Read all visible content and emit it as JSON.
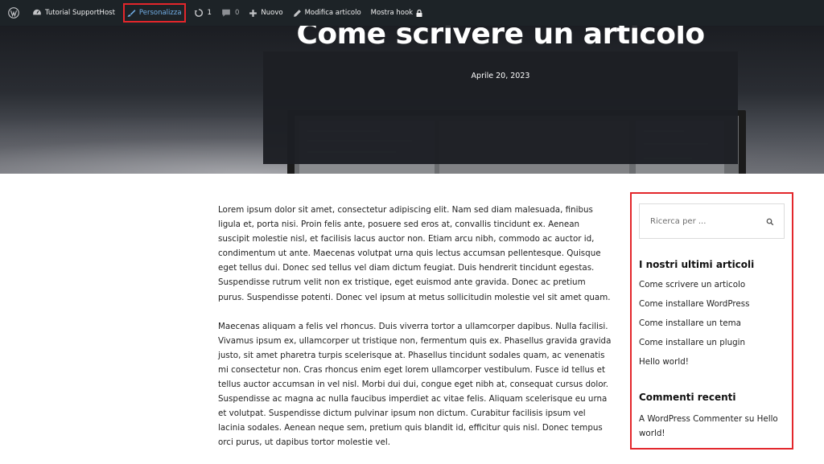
{
  "admin_bar": {
    "site_name": "Tutorial SupportHost",
    "customize_label": "Personalizza",
    "updates_count": "1",
    "comments_count": "0",
    "new_label": "Nuovo",
    "edit_label": "Modifica articolo",
    "hooks_label": "Mostra hook",
    "highlight_color": "#e3262b"
  },
  "hero": {
    "title": "Come scrivere un articolo",
    "date": "Aprile 20, 2023"
  },
  "content": {
    "paragraphs": [
      "Lorem ipsum dolor sit amet, consectetur adipiscing elit. Nam sed diam malesuada, finibus ligula et, porta nisi. Proin felis ante, posuere sed eros at, convallis tincidunt ex. Aenean suscipit molestie nisl, et facilisis lacus auctor non. Etiam arcu nibh, commodo ac auctor id, condimentum ut ante. Maecenas volutpat urna quis lectus accumsan pellentesque. Quisque eget tellus dui. Donec sed tellus vel diam dictum feugiat. Duis hendrerit tincidunt egestas. Suspendisse rutrum velit non ex tristique, eget euismod ante gravida. Donec ac pretium purus. Suspendisse potenti. Donec vel ipsum at metus sollicitudin molestie vel sit amet quam.",
      "Maecenas aliquam a felis vel rhoncus. Duis viverra tortor a ullamcorper dapibus. Nulla facilisi. Vivamus ipsum ex, ullamcorper ut tristique non, fermentum quis ex. Phasellus gravida gravida justo, sit amet pharetra turpis scelerisque at. Phasellus tincidunt sodales quam, ac venenatis mi consectetur non. Cras rhoncus enim eget lorem ullamcorper vestibulum. Fusce id tellus et tellus auctor accumsan in vel nisl. Morbi dui dui, congue eget nibh at, consequat cursus dolor. Suspendisse ac magna ac nulla faucibus imperdiet ac vitae felis. Aliquam scelerisque eu urna et volutpat. Suspendisse dictum pulvinar ipsum non dictum. Curabitur facilisis ipsum vel lacinia sodales. Aenean neque sem, pretium quis blandit id, efficitur quis nisl. Donec tempus orci purus, ut dapibus tortor molestie vel."
    ]
  },
  "sidebar": {
    "search_placeholder": "Ricerca per ...",
    "recent_posts_title": "I nostri ultimi articoli",
    "recent_posts": [
      "Come scrivere un articolo",
      "Come installare WordPress",
      "Come installare un tema",
      "Come installare un plugin",
      "Hello world!"
    ],
    "recent_comments_title": "Commenti recenti",
    "recent_comment": {
      "author": "A WordPress Commenter",
      "connector": " su ",
      "post": "Hello world!"
    }
  }
}
